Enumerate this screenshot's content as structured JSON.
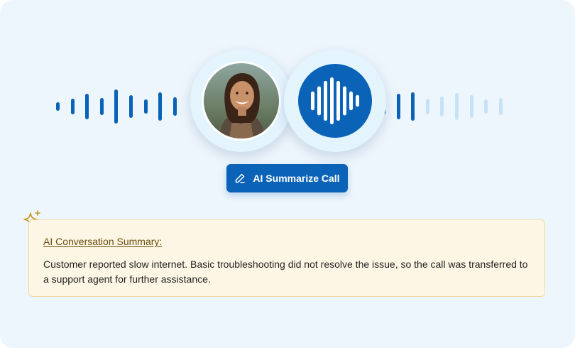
{
  "colors": {
    "card_background": "#eef6fd",
    "accent": "#0b63b8",
    "accent_light": "#c7e2f6",
    "summary_background": "#fef6e4",
    "summary_border": "#f2d9a2",
    "sparkle": "#c8951e"
  },
  "waveform": {
    "left_bars": [
      {
        "level": 0.25,
        "shade": "dark"
      },
      {
        "level": 0.45,
        "shade": "dark"
      },
      {
        "level": 0.75,
        "shade": "dark"
      },
      {
        "level": 0.5,
        "shade": "dark"
      },
      {
        "level": 1.0,
        "shade": "dark"
      },
      {
        "level": 0.65,
        "shade": "dark"
      },
      {
        "level": 0.4,
        "shade": "dark"
      },
      {
        "level": 0.85,
        "shade": "dark"
      },
      {
        "level": 0.55,
        "shade": "dark"
      }
    ],
    "right_bars": [
      {
        "level": 0.45,
        "shade": "dark"
      },
      {
        "level": 0.75,
        "shade": "dark"
      },
      {
        "level": 0.85,
        "shade": "dark"
      },
      {
        "level": 0.45,
        "shade": "light"
      },
      {
        "level": 0.6,
        "shade": "light"
      },
      {
        "level": 0.8,
        "shade": "light"
      },
      {
        "level": 0.65,
        "shade": "light"
      },
      {
        "level": 0.4,
        "shade": "light"
      },
      {
        "level": 0.5,
        "shade": "light"
      }
    ]
  },
  "avatar": {
    "icon": "person-avatar"
  },
  "voice_icon": {
    "icon": "audio-wave-icon",
    "bar_levels": [
      0.4,
      0.62,
      0.85,
      1.0,
      0.85,
      0.62,
      0.4,
      0.25
    ]
  },
  "summarize_button": {
    "label": "AI Summarize Call",
    "icon": "pencil-icon"
  },
  "summary": {
    "icon": "sparkle-icon",
    "title": "AI Conversation Summary:",
    "text": "Customer reported slow internet. Basic troubleshooting did not resolve the issue, so the call was transferred to a support agent for further assistance."
  }
}
